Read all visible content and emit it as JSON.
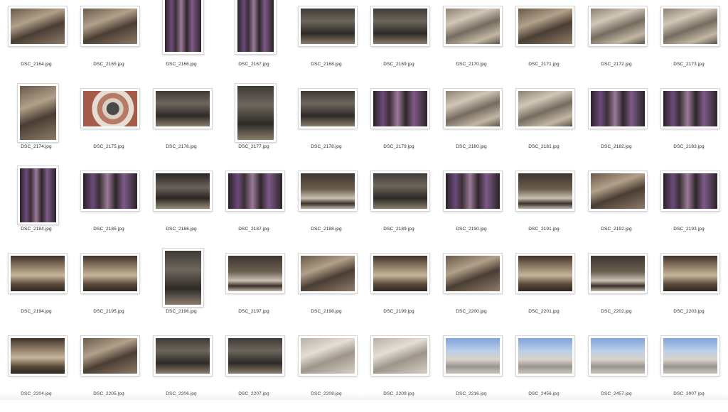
{
  "window": {
    "title": ""
  },
  "photos": [
    {
      "name": "DSC_2164.jpg",
      "orientation": "landscape",
      "tone": "interior-arch-warm"
    },
    {
      "name": "DSC_2165.jpg",
      "orientation": "landscape",
      "tone": "interior-arch-warm"
    },
    {
      "name": "DSC_2166.jpg",
      "orientation": "portrait",
      "tone": "stained-glass"
    },
    {
      "name": "DSC_2167.jpg",
      "orientation": "portrait",
      "tone": "stained-glass"
    },
    {
      "name": "DSC_2168.jpg",
      "orientation": "landscape",
      "tone": "nave-dark"
    },
    {
      "name": "DSC_2169.jpg",
      "orientation": "landscape",
      "tone": "nave-dark"
    },
    {
      "name": "DSC_2170.jpg",
      "orientation": "landscape",
      "tone": "marble-wall"
    },
    {
      "name": "DSC_2171.jpg",
      "orientation": "landscape",
      "tone": "interior-arch-warm"
    },
    {
      "name": "DSC_2172.jpg",
      "orientation": "landscape",
      "tone": "marble-wall"
    },
    {
      "name": "DSC_2173.jpg",
      "orientation": "landscape",
      "tone": "marble-wall"
    },
    {
      "name": "DSC_2174.jpg",
      "orientation": "portrait",
      "tone": "interior-arch-warm"
    },
    {
      "name": "DSC_2175.jpg",
      "orientation": "landscape",
      "tone": "floor-rose"
    },
    {
      "name": "DSC_2176.jpg",
      "orientation": "landscape",
      "tone": "nave-dark"
    },
    {
      "name": "DSC_2177.jpg",
      "orientation": "portrait",
      "tone": "nave-dark"
    },
    {
      "name": "DSC_2178.jpg",
      "orientation": "landscape",
      "tone": "nave-dark"
    },
    {
      "name": "DSC_2179.jpg",
      "orientation": "landscape",
      "tone": "stained-glass"
    },
    {
      "name": "DSC_2180.jpg",
      "orientation": "landscape",
      "tone": "marble-wall"
    },
    {
      "name": "DSC_2181.jpg",
      "orientation": "landscape",
      "tone": "marble-wall"
    },
    {
      "name": "DSC_2182.jpg",
      "orientation": "landscape",
      "tone": "stained-glass"
    },
    {
      "name": "DSC_2183.jpg",
      "orientation": "landscape",
      "tone": "stained-glass"
    },
    {
      "name": "DSC_2184.jpg",
      "orientation": "portrait",
      "tone": "stained-glass"
    },
    {
      "name": "DSC_2185.jpg",
      "orientation": "landscape",
      "tone": "stained-glass"
    },
    {
      "name": "DSC_2186.jpg",
      "orientation": "landscape",
      "tone": "statue-dark"
    },
    {
      "name": "DSC_2187.jpg",
      "orientation": "landscape",
      "tone": "stained-glass"
    },
    {
      "name": "DSC_2188.jpg",
      "orientation": "landscape",
      "tone": "floor-marble"
    },
    {
      "name": "DSC_2189.jpg",
      "orientation": "landscape",
      "tone": "nave-dark"
    },
    {
      "name": "DSC_2190.jpg",
      "orientation": "landscape",
      "tone": "stained-glass"
    },
    {
      "name": "DSC_2191.jpg",
      "orientation": "landscape",
      "tone": "floor-marble"
    },
    {
      "name": "DSC_2192.jpg",
      "orientation": "landscape",
      "tone": "interior-arch-warm"
    },
    {
      "name": "DSC_2193.jpg",
      "orientation": "landscape",
      "tone": "stained-glass"
    },
    {
      "name": "DSC_2194.jpg",
      "orientation": "landscape",
      "tone": "nave-warm"
    },
    {
      "name": "DSC_2195.jpg",
      "orientation": "landscape",
      "tone": "nave-warm"
    },
    {
      "name": "DSC_2196.jpg",
      "orientation": "portrait",
      "tone": "nave-dark"
    },
    {
      "name": "DSC_2197.jpg",
      "orientation": "landscape",
      "tone": "floor-marble"
    },
    {
      "name": "DSC_2198.jpg",
      "orientation": "landscape",
      "tone": "interior-arch-warm"
    },
    {
      "name": "DSC_2199.jpg",
      "orientation": "landscape",
      "tone": "nave-warm"
    },
    {
      "name": "DSC_2200.jpg",
      "orientation": "landscape",
      "tone": "interior-arch-warm"
    },
    {
      "name": "DSC_2201.jpg",
      "orientation": "landscape",
      "tone": "nave-warm"
    },
    {
      "name": "DSC_2202.jpg",
      "orientation": "landscape",
      "tone": "floor-marble"
    },
    {
      "name": "DSC_2203.jpg",
      "orientation": "landscape",
      "tone": "nave-warm"
    },
    {
      "name": "DSC_2204.jpg",
      "orientation": "landscape",
      "tone": "nave-warm"
    },
    {
      "name": "DSC_2205.jpg",
      "orientation": "landscape",
      "tone": "interior-arch-warm"
    },
    {
      "name": "DSC_2206.jpg",
      "orientation": "landscape",
      "tone": "nave-dark"
    },
    {
      "name": "DSC_2207.jpg",
      "orientation": "landscape",
      "tone": "nave-dark"
    },
    {
      "name": "DSC_2208.jpg",
      "orientation": "landscape",
      "tone": "relief-light"
    },
    {
      "name": "DSC_2209.jpg",
      "orientation": "landscape",
      "tone": "relief-light"
    },
    {
      "name": "DSC_2216.jpg",
      "orientation": "landscape",
      "tone": "exterior-sky"
    },
    {
      "name": "DSC_2456.jpg",
      "orientation": "landscape",
      "tone": "exterior-sky"
    },
    {
      "name": "DSC_2457.jpg",
      "orientation": "landscape",
      "tone": "exterior-sky"
    },
    {
      "name": "DSC_3007.jpg",
      "orientation": "landscape",
      "tone": "exterior-sky"
    }
  ]
}
